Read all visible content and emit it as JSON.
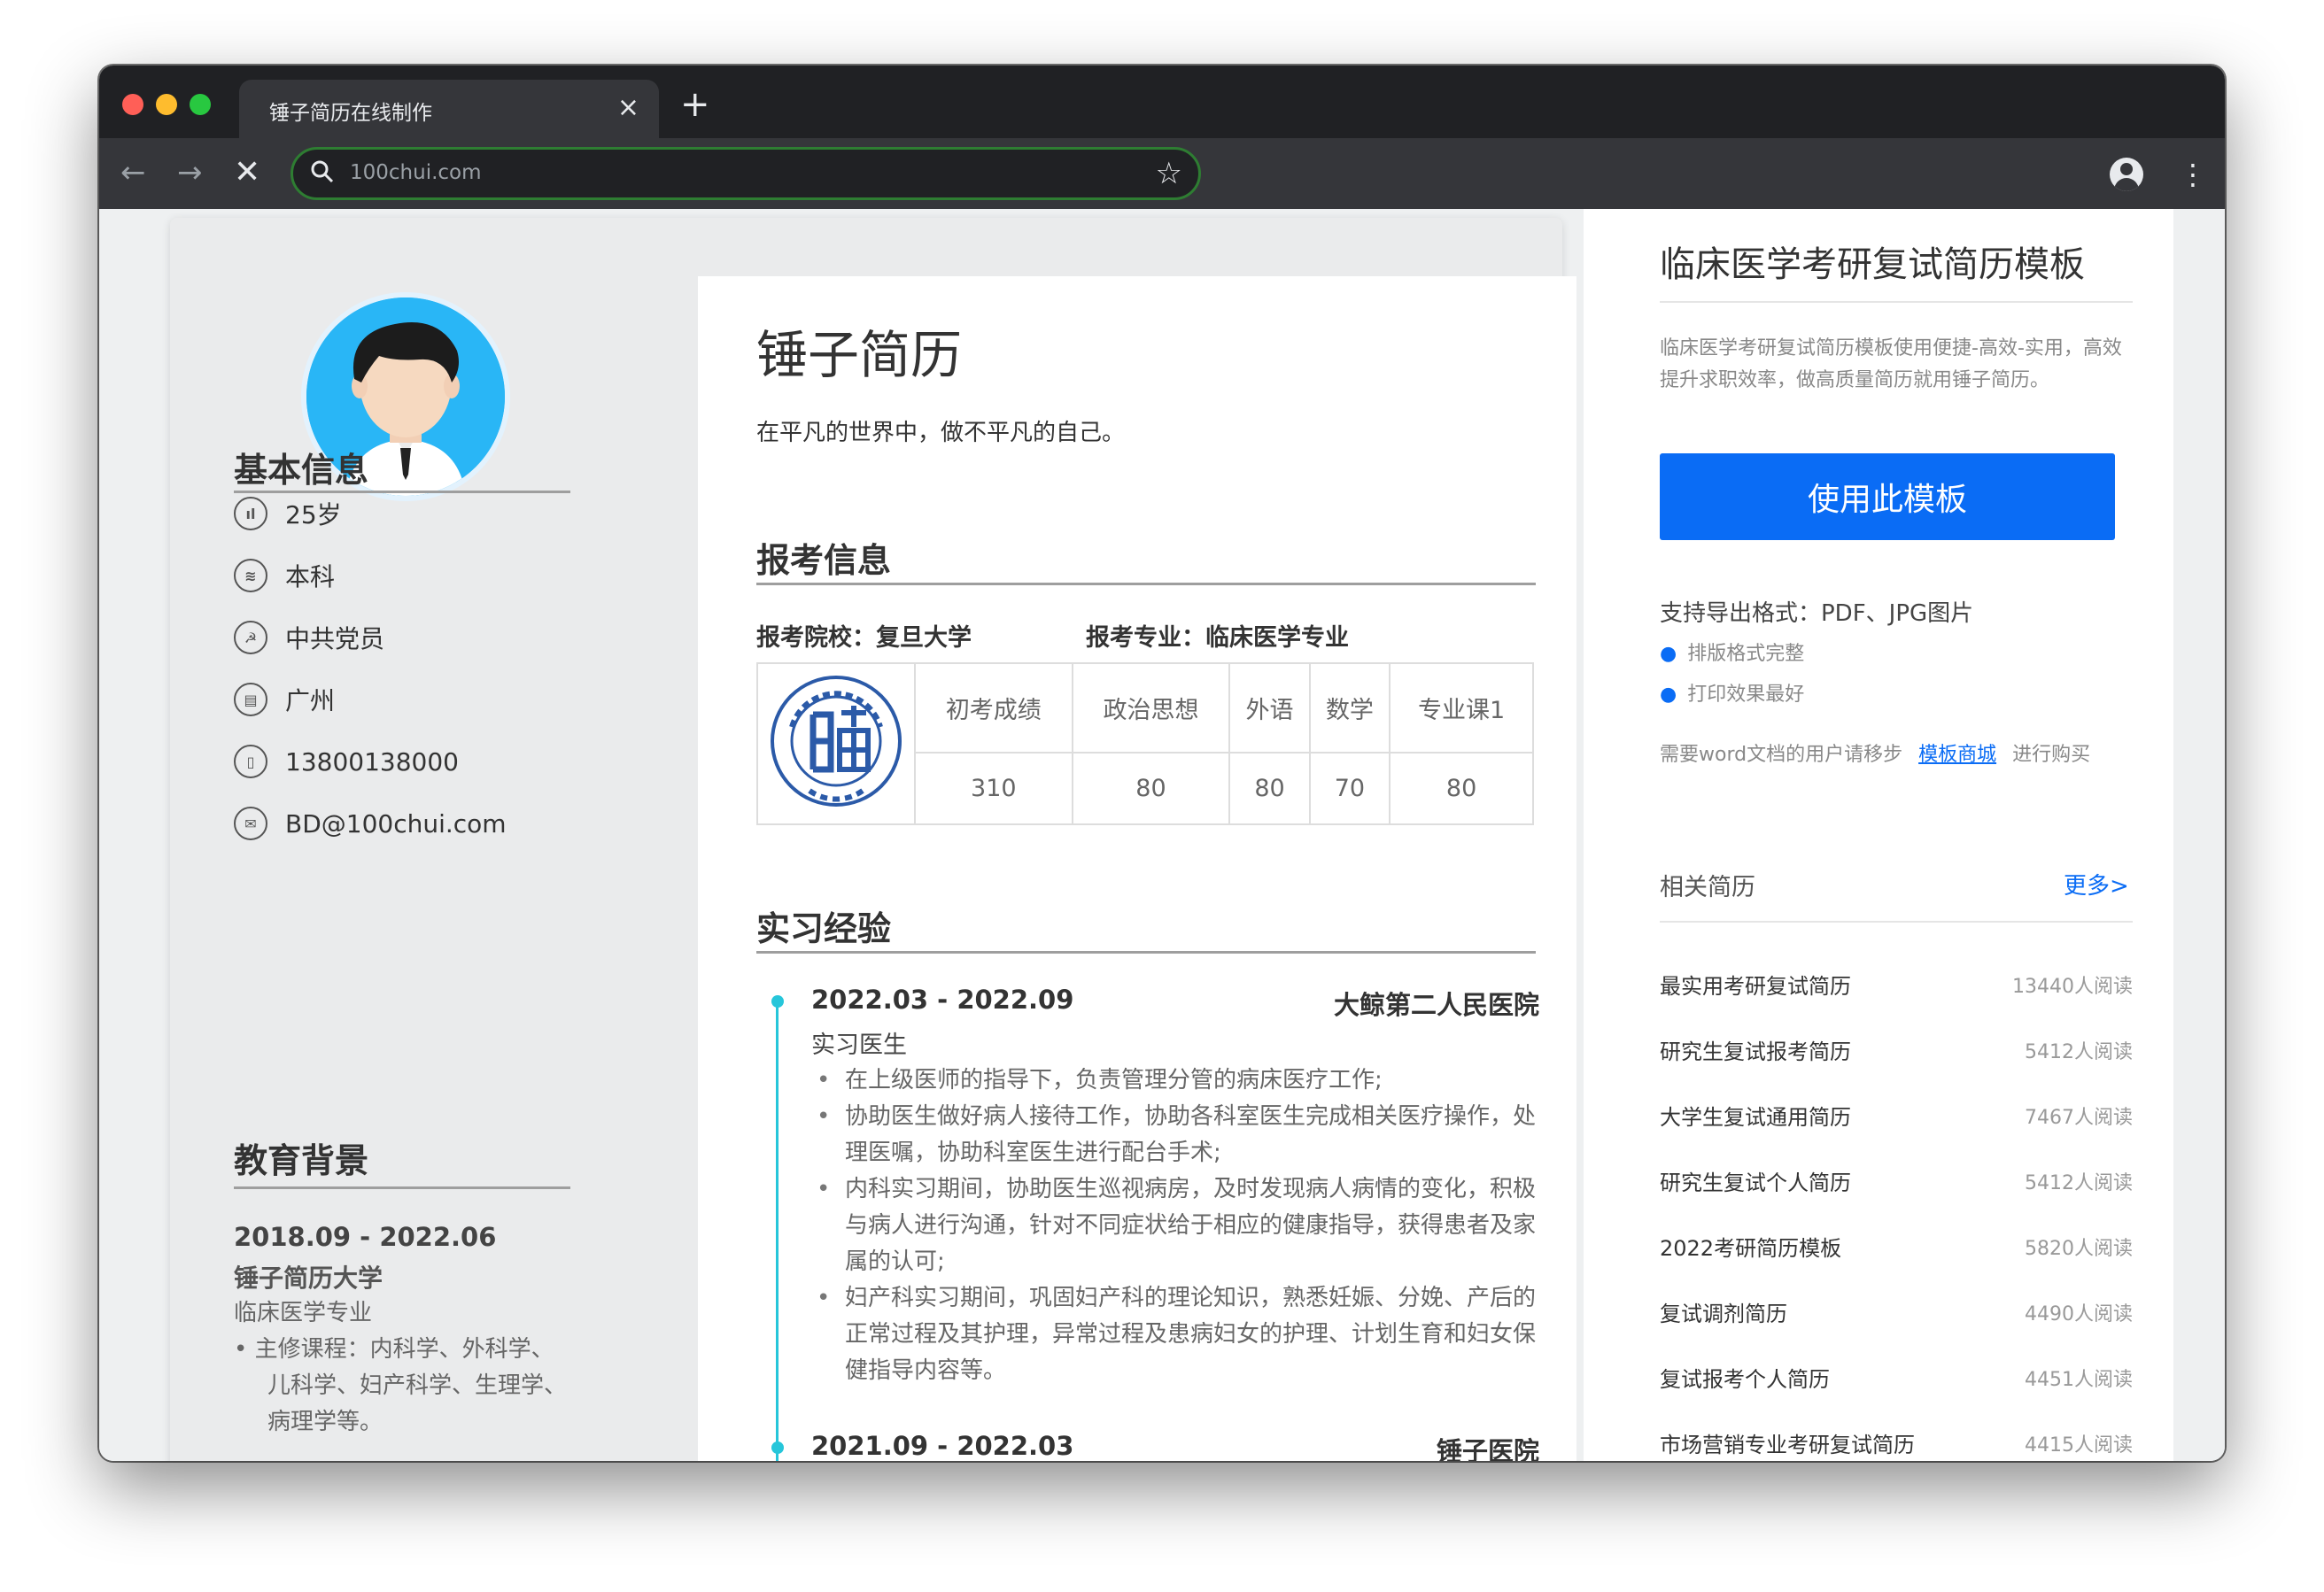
{
  "browser": {
    "tab_title": "锤子简历在线制作",
    "tab_close": "×",
    "new_tab": "+",
    "url": "100chui.com"
  },
  "resume": {
    "name": "锤子简历",
    "motto": "在平凡的世界中，做不平凡的自己。",
    "basic": {
      "title": "基本信息",
      "items": [
        {
          "icon": "age-chart-icon",
          "glyph": "ıl",
          "text": "25岁"
        },
        {
          "icon": "education-icon",
          "glyph": "≋",
          "text": "本科"
        },
        {
          "icon": "party-icon",
          "glyph": "☭",
          "text": "中共党员"
        },
        {
          "icon": "building-icon",
          "glyph": "▤",
          "text": "广州"
        },
        {
          "icon": "phone-icon",
          "glyph": "▯",
          "text": "13800138000"
        },
        {
          "icon": "mail-icon",
          "glyph": "✉",
          "text": "BD@100chui.com"
        }
      ]
    },
    "education": {
      "title": "教育背景",
      "date": "2018.09 - 2022.06",
      "school": "锤子简历大学",
      "major": "临床医学专业",
      "courses": "•  主修课程：内科学、外科学、儿科学、妇产科学、生理学、病理学等。"
    },
    "apply": {
      "title": "报考信息",
      "school_label": "报考院校：复旦大学",
      "major_label": "报考专业：临床医学专业",
      "headers": [
        "初考成绩",
        "政治思想",
        "外语",
        "数学",
        "专业课1"
      ],
      "scores": [
        "310",
        "80",
        "80",
        "70",
        "80"
      ]
    },
    "experience": {
      "title": "实习经验",
      "entries": [
        {
          "date": "2022.03 - 2022.09",
          "org": "大鲸第二人民医院",
          "role": "实习医生",
          "bullets": [
            "在上级医师的指导下，负责管理分管的病床医疗工作;",
            "协助医生做好病人接待工作，协助各科室医生完成相关医疗操作，处理医嘱，协助科室医生进行配台手术;",
            "内科实习期间，协助医生巡视病房，及时发现病人病情的变化，积极与病人进行沟通，针对不同症状给于相应的健康指导，获得患者及家属的认可;",
            "妇产科实习期间，巩固妇产科的理论知识，熟悉妊娠、分娩、产后的正常过程及其护理，异常过程及患病妇女的护理、计划生育和妇女保健指导内容等。"
          ]
        },
        {
          "date": "2021.09 - 2022.03",
          "org": "锤子医院"
        }
      ]
    }
  },
  "sidebar": {
    "title": "临床医学考研复试简历模板",
    "description": "临床医学考研复试简历模板使用便捷-高效-实用，高效提升求职效率，做高质量简历就用锤子简历。",
    "use_button": "使用此模板",
    "formats": "支持导出格式：PDF、JPG图片",
    "bullets": [
      "排版格式完整",
      "打印效果最好"
    ],
    "word_prefix": "需要word文档的用户请移步",
    "word_link": "模板商城",
    "word_suffix": "进行购买",
    "related_title": "相关简历",
    "more": "更多>",
    "related": [
      {
        "name": "最实用考研复试简历",
        "count": "13440人阅读"
      },
      {
        "name": "研究生复试报考简历",
        "count": "5412人阅读"
      },
      {
        "name": "大学生复试通用简历",
        "count": "7467人阅读"
      },
      {
        "name": "研究生复试个人简历",
        "count": "5412人阅读"
      },
      {
        "name": "2022考研简历模板",
        "count": "5820人阅读"
      },
      {
        "name": "复试调剂简历",
        "count": "4490人阅读"
      },
      {
        "name": "复试报考个人简历",
        "count": "4451人阅读"
      },
      {
        "name": "市场营销专业考研复试简历",
        "count": "4415人阅读"
      }
    ]
  }
}
